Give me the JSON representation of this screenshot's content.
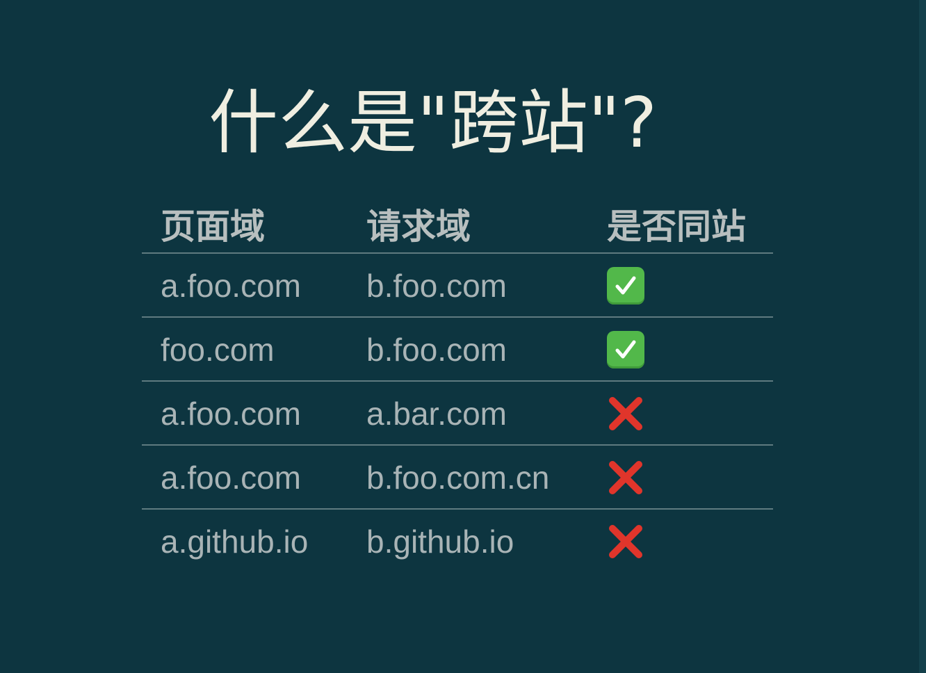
{
  "title": "什么是\"跨站\"?",
  "table": {
    "headers": [
      "页面域",
      "请求域",
      "是否同站"
    ],
    "rows": [
      {
        "page_domain": "a.foo.com",
        "request_domain": "b.foo.com",
        "same_site": "check-icon"
      },
      {
        "page_domain": "foo.com",
        "request_domain": "b.foo.com",
        "same_site": "check-icon"
      },
      {
        "page_domain": "a.foo.com",
        "request_domain": "a.bar.com",
        "same_site": "cross-icon"
      },
      {
        "page_domain": "a.foo.com",
        "request_domain": "b.foo.com.cn",
        "same_site": "cross-icon"
      },
      {
        "page_domain": "a.github.io",
        "request_domain": "b.github.io",
        "same_site": "cross-icon"
      }
    ]
  },
  "colors": {
    "background": "#0d3540",
    "title": "#efeee1",
    "header_text": "#b8bfbf",
    "cell_text": "#a9b4b6",
    "divider": "#5f7b80",
    "check_green": "#52b84a",
    "cross_red": "#e0352b"
  }
}
